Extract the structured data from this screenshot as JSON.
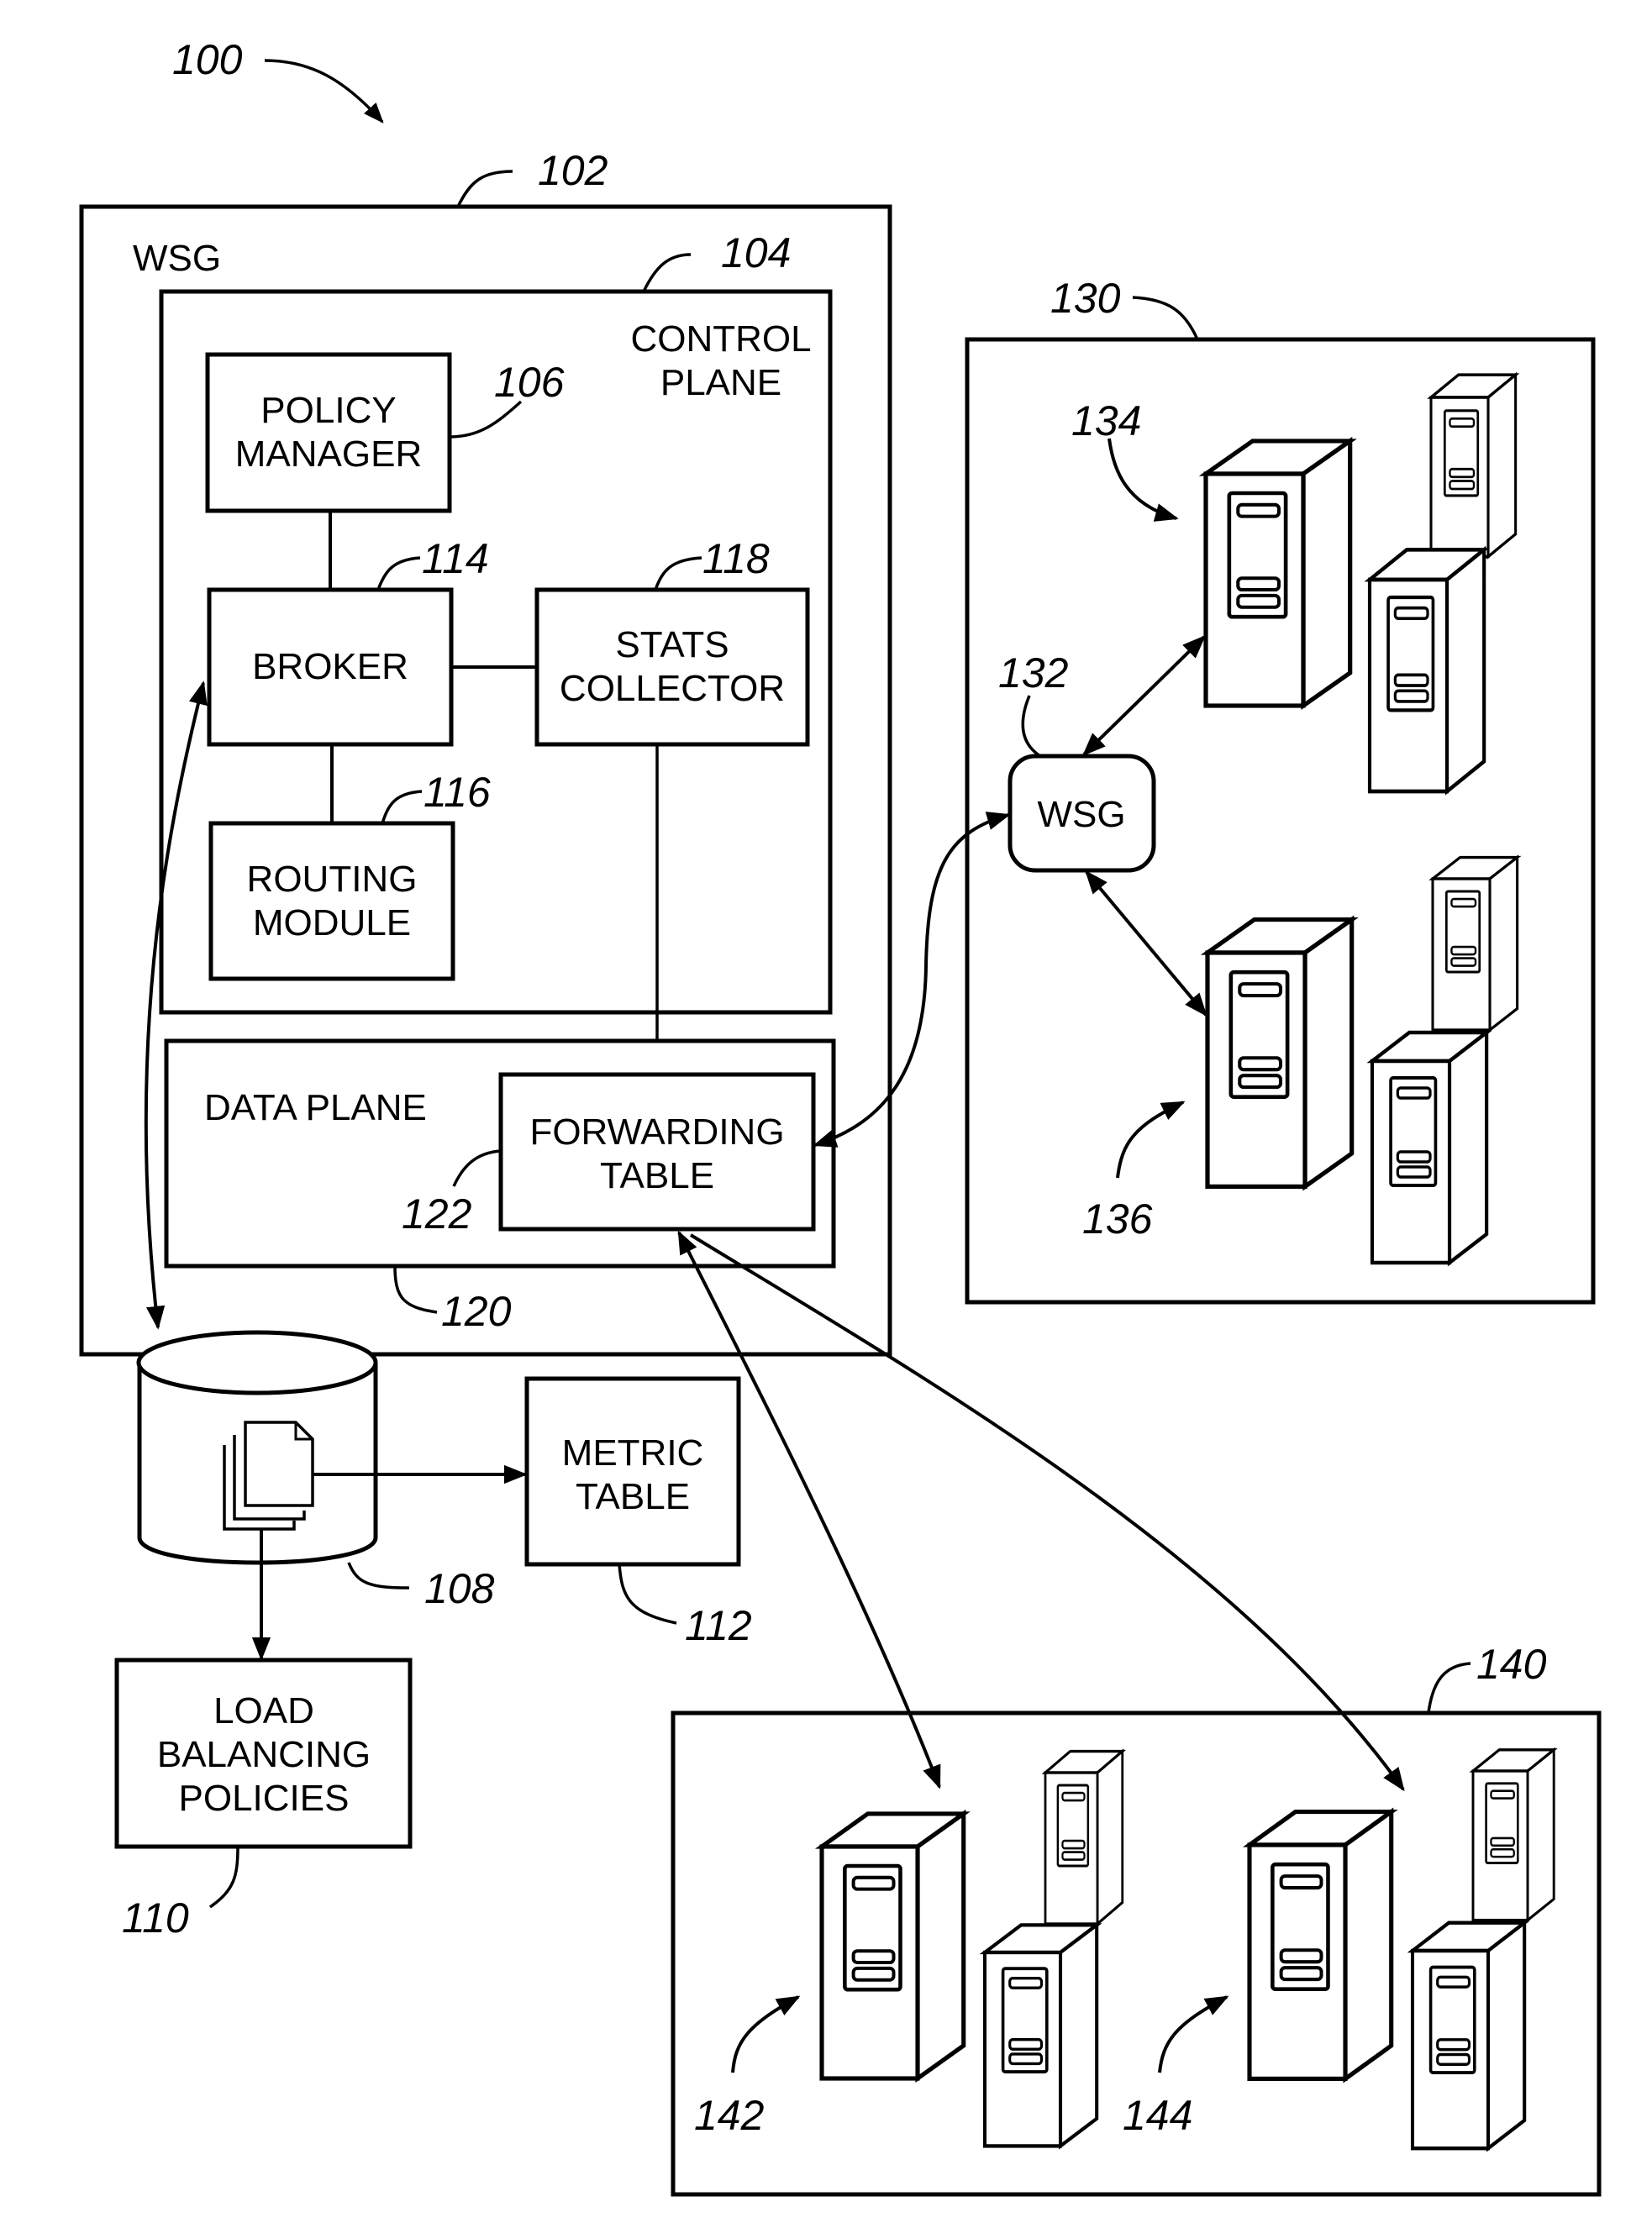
{
  "figure": {
    "ref_overall": "100",
    "colors": {
      "ink": "#000000",
      "paper": "#ffffff"
    }
  },
  "wsg": {
    "ref": "102",
    "title": "WSG",
    "control_plane": {
      "ref": "104",
      "title_line1": "CONTROL",
      "title_line2": "PLANE"
    },
    "policy_manager": {
      "ref": "106",
      "line1": "POLICY",
      "line2": "MANAGER"
    },
    "broker": {
      "ref": "114",
      "label": "BROKER"
    },
    "stats_collector": {
      "ref": "118",
      "line1": "STATS",
      "line2": "COLLECTOR"
    },
    "routing_module": {
      "ref": "116",
      "line1": "ROUTING",
      "line2": "MODULE"
    },
    "data_plane": {
      "ref": "120",
      "title": "DATA PLANE"
    },
    "forwarding_table": {
      "ref": "122",
      "line1": "FORWARDING",
      "line2": "TABLE"
    }
  },
  "database": {
    "ref": "108",
    "icon": "documents-icon"
  },
  "metric_table": {
    "ref": "112",
    "line1": "METRIC",
    "line2": "TABLE"
  },
  "load_balancing": {
    "ref": "110",
    "line1": "LOAD",
    "line2": "BALANCING",
    "line3": "POLICIES"
  },
  "site_130": {
    "ref": "130",
    "gateway": {
      "ref": "132",
      "label": "WSG"
    },
    "server_group_a": {
      "ref": "134",
      "icon": "server-icon"
    },
    "server_group_b": {
      "ref": "136",
      "icon": "server-icon"
    }
  },
  "site_140": {
    "ref": "140",
    "server_group_a": {
      "ref": "142",
      "icon": "server-icon"
    },
    "server_group_b": {
      "ref": "144",
      "icon": "server-icon"
    }
  }
}
